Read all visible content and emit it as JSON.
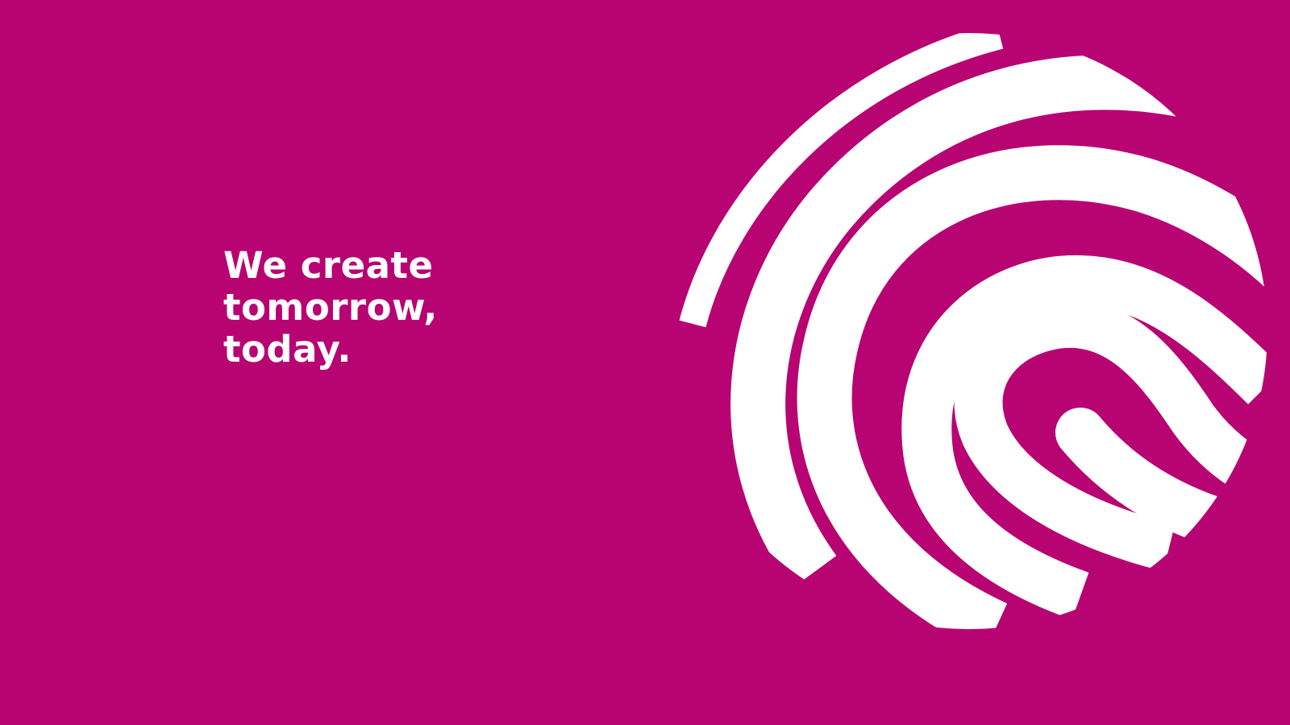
{
  "slide": {
    "background_color": "#B80373",
    "text_color": "#FFFFFF",
    "mark_color": "#FFFFFF",
    "mark_icon": "fingerprint-logo-icon",
    "headline": {
      "line1": "We create",
      "line2": "tomorrow,",
      "line3": "today."
    }
  }
}
